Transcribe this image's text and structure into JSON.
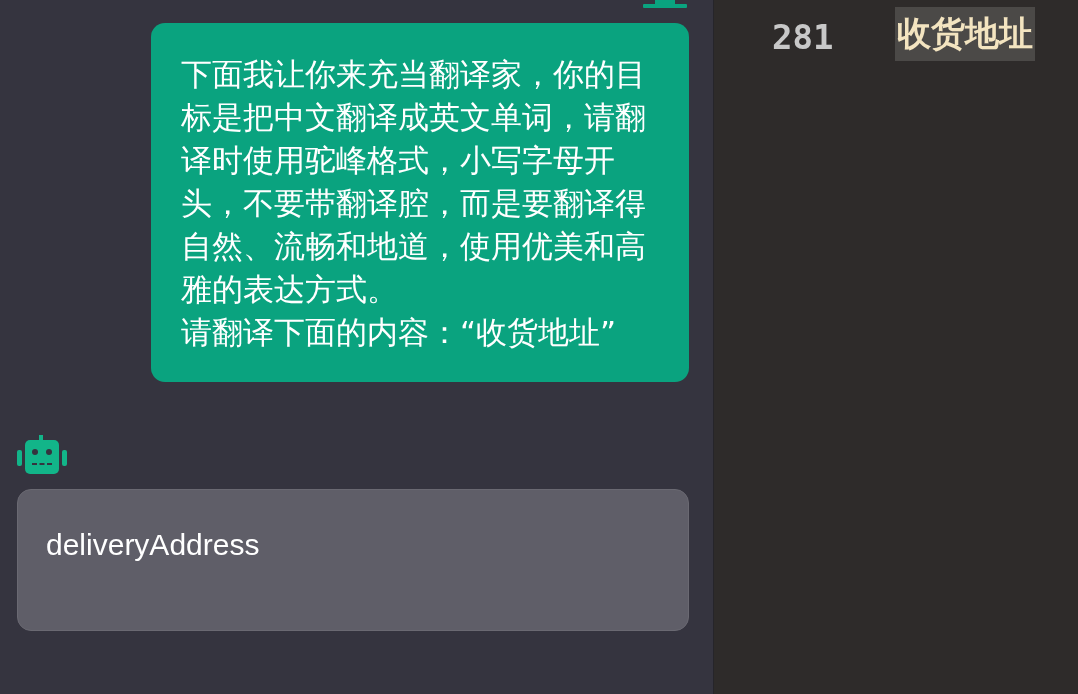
{
  "chat": {
    "messages": [
      {
        "kind": "user",
        "paragraphs": [
          "下面我让你来充当翻译家，你的目标是把中文翻译成英文单词，请翻译时使用驼峰格式，小写字母开头，不要带翻译腔，而是要翻译得自然、流畅和地道，使用优美和高雅的表达方式。",
          "请翻译下面的内容：“收货地址”"
        ]
      },
      {
        "kind": "bot",
        "paragraphs": [
          "deliveryAddress"
        ]
      }
    ]
  },
  "editor": {
    "line_number": "281",
    "line_text": "收货地址",
    "highlighted": true
  }
}
